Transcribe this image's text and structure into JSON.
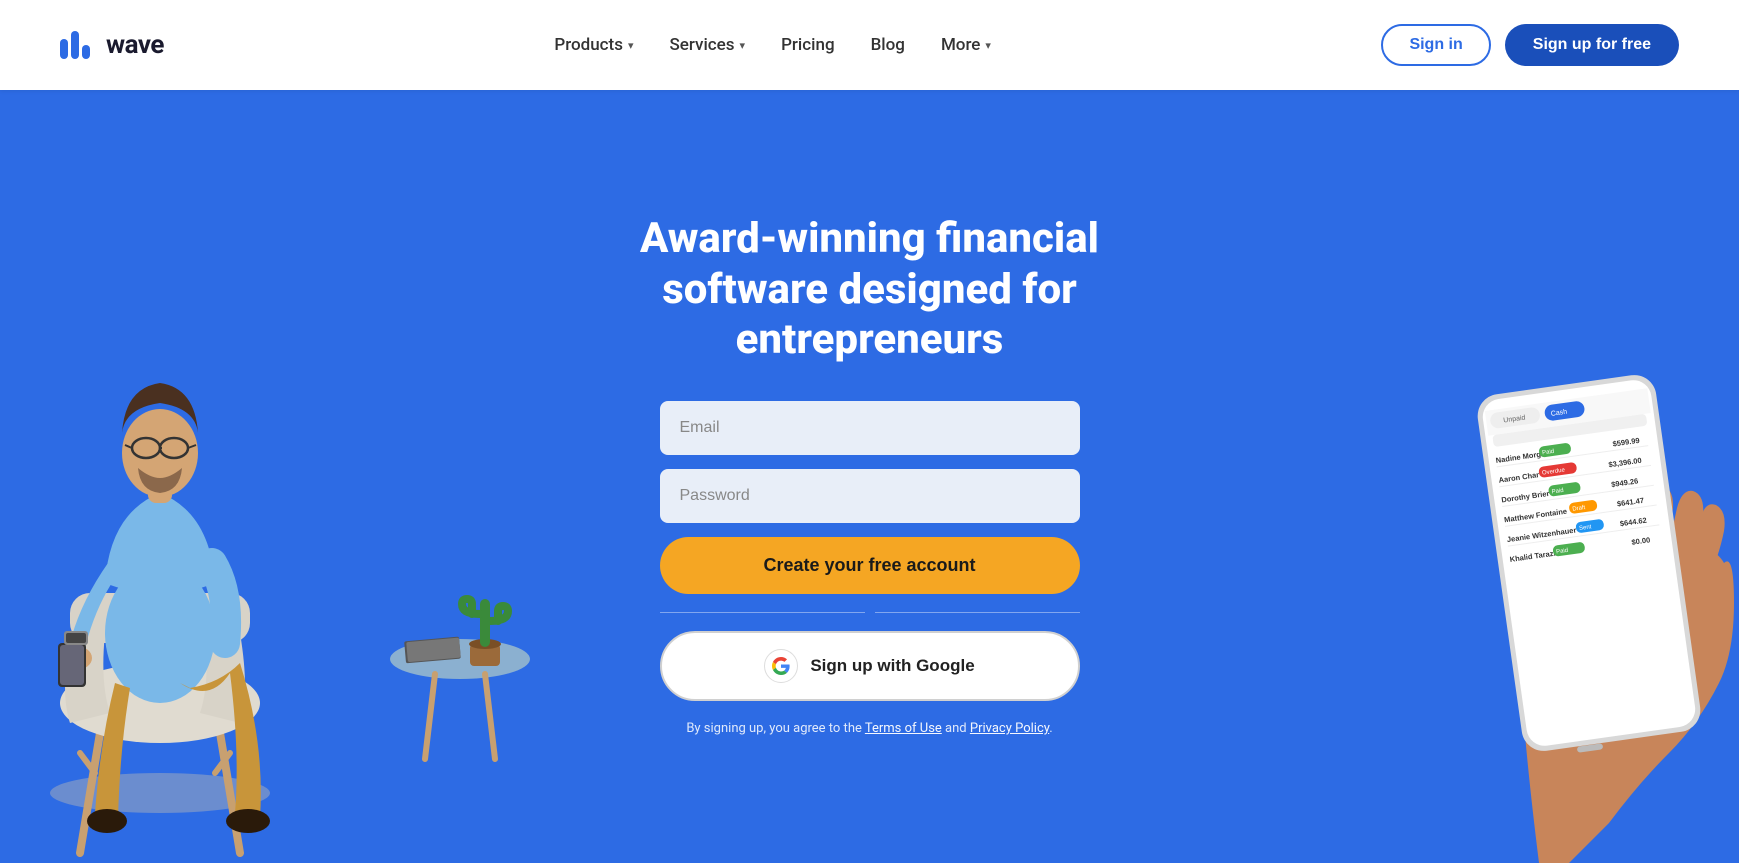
{
  "navbar": {
    "logo_text": "wave",
    "nav_items": [
      {
        "label": "Products",
        "has_dropdown": true
      },
      {
        "label": "Services",
        "has_dropdown": true
      },
      {
        "label": "Pricing",
        "has_dropdown": false
      },
      {
        "label": "Blog",
        "has_dropdown": false
      },
      {
        "label": "More",
        "has_dropdown": true
      }
    ],
    "signin_label": "Sign in",
    "signup_label": "Sign up for free"
  },
  "hero": {
    "title": "Award-winning financial software designed for entrepreneurs",
    "email_placeholder": "Email",
    "password_placeholder": "Password",
    "create_account_label": "Create your free account",
    "google_signup_label": "Sign up with Google",
    "terms_text": "By signing up, you agree to the",
    "terms_link": "Terms of Use",
    "and_text": "and",
    "privacy_link": "Privacy Policy",
    "period": "."
  },
  "phone_data": {
    "tabs": [
      "Unpaid",
      "Cash"
    ],
    "active_tab": "Cash",
    "rows": [
      {
        "name": "Nadine Morgan",
        "badge": "green",
        "badge_label": "Paid",
        "amount": "$599.99"
      },
      {
        "name": "Aaron Char",
        "badge": "red",
        "badge_label": "Overdue",
        "amount": "$3,396.00"
      },
      {
        "name": "Dorothy Brier",
        "badge": "green",
        "badge_label": "Paid",
        "amount": "$949.26"
      },
      {
        "name": "Matthew Fontaine",
        "badge": "yellow",
        "badge_label": "Draft",
        "amount": "$641.47"
      },
      {
        "name": "Jeanie Witzenhauer",
        "badge": "blue",
        "badge_label": "Sent",
        "amount": "$644.62"
      },
      {
        "name": "Khalid Tarazi",
        "badge": "green",
        "badge_label": "Paid",
        "amount": "$0.00"
      }
    ]
  },
  "colors": {
    "brand_blue": "#2d6be4",
    "dark_blue": "#1a4fba",
    "orange": "#f5a623",
    "hero_bg": "#2d6be4"
  }
}
